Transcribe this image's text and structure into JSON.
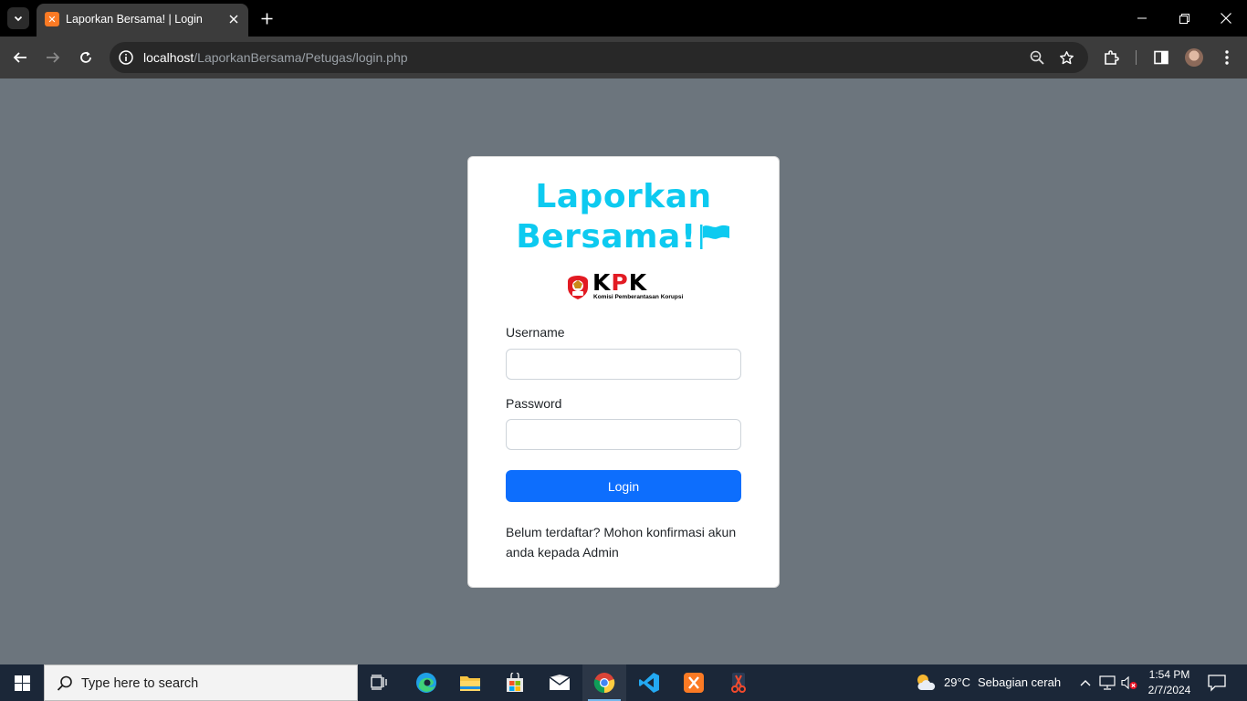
{
  "browser": {
    "tab_title": "Laporkan Bersama! | Login",
    "tab_favicon_glyph": "✕",
    "url_host": "localhost",
    "url_path": "/LaporkanBersama/Petugas/login.php"
  },
  "page": {
    "brand_line1": "Laporkan",
    "brand_line2": "Bersama!",
    "brand_color": "#0dcaf0",
    "logo": {
      "letters_k": "K",
      "letters_p": "P",
      "letters_k2": "K",
      "subtitle": "Komisi Pemberantasan Korupsi"
    },
    "username_label": "Username",
    "username_value": "",
    "password_label": "Password",
    "password_value": "",
    "login_label": "Login",
    "login_color": "#0d6efd",
    "note": "Belum terdaftar? Mohon konfirmasi akun anda kepada Admin"
  },
  "taskbar": {
    "search_placeholder": "Type here to search",
    "apps": [
      "task-view",
      "edge",
      "file-explorer",
      "microsoft-store",
      "mail",
      "chrome",
      "vscode",
      "xampp",
      "snipping-tool"
    ],
    "weather_temp": "29°C",
    "weather_desc": "Sebagian cerah",
    "time": "1:54 PM",
    "date": "2/7/2024"
  }
}
